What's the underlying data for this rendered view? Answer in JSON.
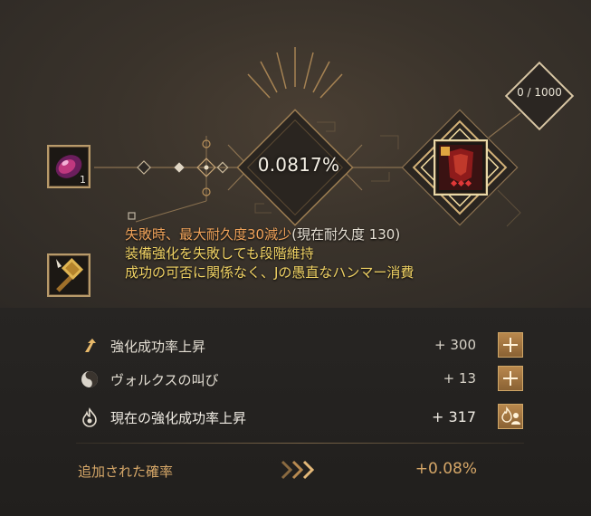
{
  "enhance": {
    "probability": "0.0817%",
    "stack_count": "0 / 1000",
    "material_count": "1"
  },
  "description": {
    "warning": "失敗時、最大耐久度30減少",
    "current": "(現在耐久度 130)",
    "line2": "装備強化を失敗しても段階維持",
    "line3": "成功の可否に関係なく、Jの愚直なハンマー消費"
  },
  "bonuses": [
    {
      "icon": "arrow-up-icon",
      "label": "強化成功率上昇",
      "value": "+ 300"
    },
    {
      "icon": "valks-cry-icon",
      "label": "ヴォルクスの叫び",
      "value": "+ 13"
    },
    {
      "icon": "flame-icon",
      "label": "現在の強化成功率上昇",
      "value": "+ 317"
    }
  ],
  "added": {
    "label": "追加された確率",
    "value": "+0.08%"
  },
  "colors": {
    "accent_gold": "#d6a768",
    "warning_orange": "#f0a35a",
    "text_gold": "#f0d264"
  }
}
